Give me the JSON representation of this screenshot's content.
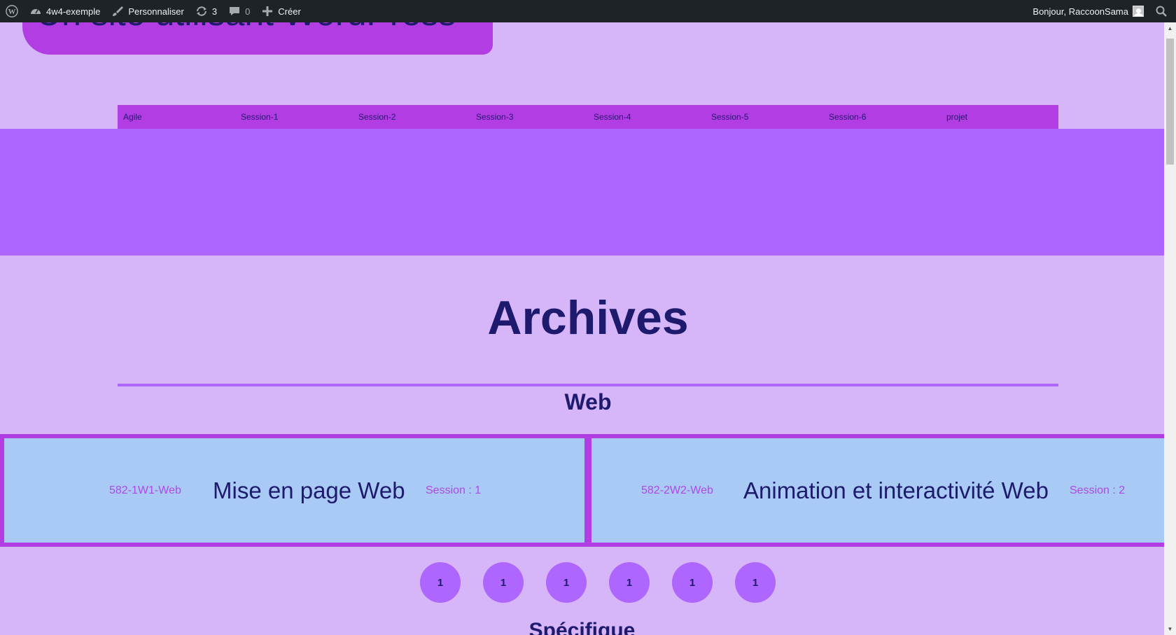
{
  "adminbar": {
    "site_name": "4w4-exemple",
    "customize": "Personnaliser",
    "updates_count": "3",
    "comments_count": "0",
    "new_label": "Créer",
    "greeting": "Bonjour, RaccoonSama"
  },
  "header": {
    "site_title": "Un site utilisant WordPress"
  },
  "menu": {
    "items": [
      "Agile",
      "Session-1",
      "Session-2",
      "Session-3",
      "Session-4",
      "Session-5",
      "Session-6",
      "projet"
    ]
  },
  "main": {
    "page_title": "Archives",
    "section_title": "Web",
    "cards": [
      {
        "code": "582-1W1-Web",
        "name": "Mise en page Web",
        "session": "Session : 1"
      },
      {
        "code": "582-2W2-Web",
        "name": "Animation et interactivité Web",
        "session": "Session : 2"
      }
    ],
    "circles": [
      "1",
      "1",
      "1",
      "1",
      "1",
      "1"
    ],
    "section_title_2": "Spécifique"
  },
  "colors": {
    "background": "#d6b5f8",
    "accent": "#b23de3",
    "hero": "#ae66fe",
    "card": "#a8caf4",
    "text": "#1e1a6e"
  }
}
